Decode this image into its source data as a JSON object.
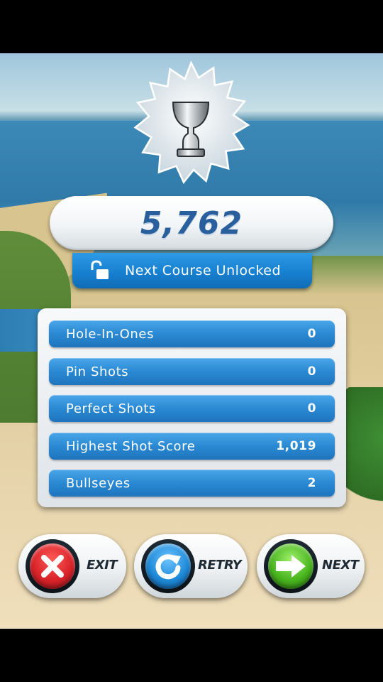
{
  "score": "5,762",
  "unlock": {
    "text": "Next Course Unlocked",
    "icon": "unlocked-padlock-icon"
  },
  "badge": {
    "icon": "silver-trophy-icon"
  },
  "stats": [
    {
      "label": "Hole-In-Ones",
      "value": "0"
    },
    {
      "label": "Pin Shots",
      "value": "0"
    },
    {
      "label": "Perfect Shots",
      "value": "0"
    },
    {
      "label": "Highest Shot Score",
      "value": "1,019"
    },
    {
      "label": "Bullseyes",
      "value": "2"
    }
  ],
  "buttons": {
    "exit": {
      "label": "EXIT",
      "icon": "close-icon",
      "color": "#d8232a"
    },
    "retry": {
      "label": "RETRY",
      "icon": "refresh-icon",
      "color": "#1f8ad8"
    },
    "next": {
      "label": "NEXT",
      "icon": "arrow-right-icon",
      "color": "#49b51f"
    }
  }
}
